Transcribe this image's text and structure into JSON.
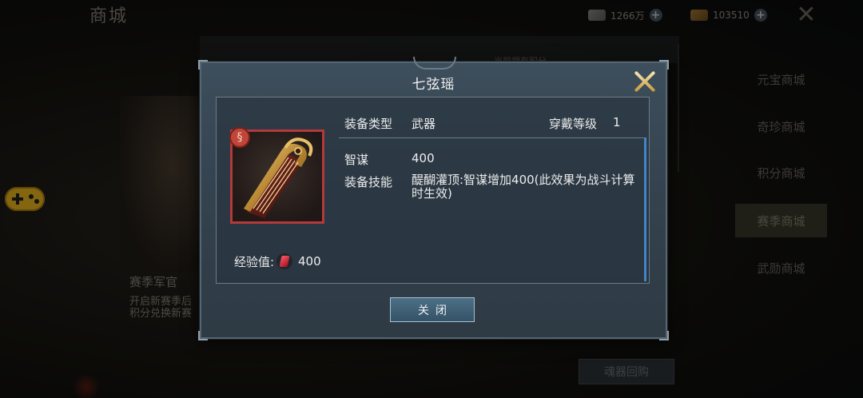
{
  "background": {
    "shop_title": "商城",
    "currency_1": "1266万",
    "currency_2": "103510",
    "points_label": "当前拥有积分",
    "side_tabs": [
      {
        "label": "元宝商城"
      },
      {
        "label": "奇珍商城"
      },
      {
        "label": "积分商城"
      },
      {
        "label": "赛季商城"
      },
      {
        "label": "武勋商城"
      }
    ],
    "officer_title": "赛季军官",
    "officer_desc_1": "开启新赛季后",
    "officer_desc_2": "积分兑换新赛",
    "buyback_label": "魂器回购"
  },
  "dialog": {
    "title": "七弦瑶",
    "equip_type_label": "装备类型",
    "equip_type_value": "武器",
    "wear_level_label": "穿戴等级",
    "wear_level_value": "1",
    "stat_label": "智谋",
    "stat_value": "400",
    "skill_label": "装备技能",
    "skill_value": "醍醐灌顶:智谋增加400(此效果为战斗计算时生效)",
    "exp_label": "经验值:",
    "exp_value": "400",
    "close_label": "关闭"
  },
  "colors": {
    "accent_blue": "#3f87c8",
    "quality_red": "#b3393a",
    "close_gold": "#e6c070"
  }
}
